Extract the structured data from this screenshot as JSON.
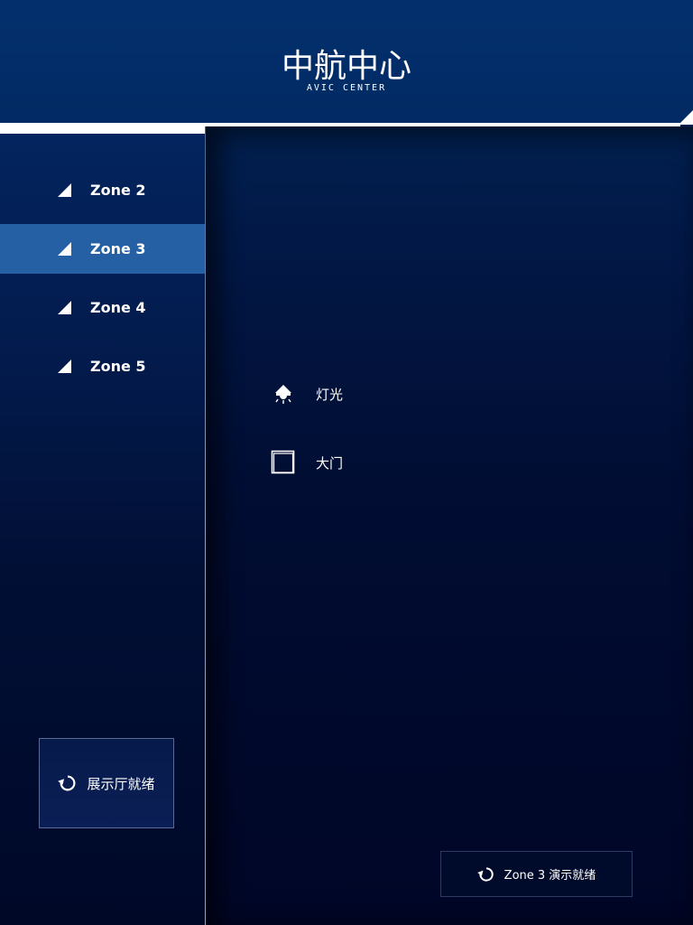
{
  "header": {
    "logo_main": "中航中心",
    "logo_sub": "AVIC CENTER"
  },
  "sidebar": {
    "items": [
      {
        "label": "Zone 2",
        "active": false
      },
      {
        "label": "Zone 3",
        "active": true
      },
      {
        "label": "Zone 4",
        "active": false
      },
      {
        "label": "Zone 5",
        "active": false
      }
    ],
    "ready_button_label": "展示厅就绪"
  },
  "main": {
    "controls": [
      {
        "label": "灯光",
        "icon": "lamp-icon"
      },
      {
        "label": "大门",
        "icon": "door-icon"
      }
    ],
    "zone_ready_button_label": "Zone 3 演示就绪"
  },
  "colors": {
    "accent_active": "#2560a4",
    "divider": "#a8b23a",
    "background": "#000625"
  }
}
